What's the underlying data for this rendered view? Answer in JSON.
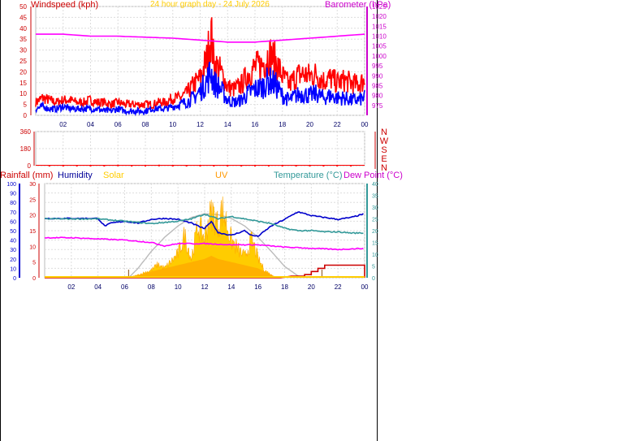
{
  "chart_data": [
    {
      "type": "line",
      "title": "24 hour graph day - 24 July 2026",
      "left_label": "Windspeed (kph)",
      "right_label": "Barometer (hPa)",
      "y_left": {
        "min": 0,
        "max": 50,
        "ticks": [
          0,
          5,
          10,
          15,
          20,
          25,
          30,
          35,
          40,
          45,
          50
        ]
      },
      "y_right": {
        "min": 970,
        "max": 1025,
        "ticks": [
          975,
          980,
          985,
          990,
          995,
          1000,
          1005,
          1010,
          1015,
          1020,
          1025
        ]
      },
      "x_ticks": [
        "02",
        "04",
        "06",
        "08",
        "10",
        "12",
        "14",
        "16",
        "18",
        "20",
        "22",
        "00"
      ],
      "series": [
        {
          "name": "Gust",
          "color": "#ff0000",
          "axis": "left",
          "x": [
            0,
            0.5,
            1,
            1.5,
            2,
            2.5,
            3,
            3.5,
            4,
            4.5,
            5,
            5.5,
            6,
            6.5,
            7,
            7.5,
            8,
            8.5,
            9,
            9.5,
            10,
            10.5,
            11,
            11.5,
            12,
            12.5,
            12.8,
            13,
            13.5,
            14,
            14.5,
            15,
            15.5,
            16,
            16.5,
            17,
            17.5,
            18,
            18.5,
            19,
            19.5,
            20,
            20.5,
            21,
            21.5,
            22,
            22.5,
            23,
            23.5,
            24
          ],
          "values": [
            6,
            8,
            7,
            6,
            7,
            7,
            6,
            6,
            7,
            6,
            6,
            5,
            6,
            5,
            5,
            5,
            5,
            5,
            6,
            6,
            8,
            8,
            10,
            14,
            17,
            26,
            38,
            24,
            20,
            13,
            12,
            14,
            19,
            22,
            23,
            28,
            25,
            18,
            14,
            18,
            19,
            18,
            19,
            16,
            17,
            15,
            16,
            15,
            14,
            16
          ]
        },
        {
          "name": "Wind",
          "color": "#0000ff",
          "axis": "left",
          "x": [
            0,
            0.5,
            1,
            1.5,
            2,
            2.5,
            3,
            3.5,
            4,
            4.5,
            5,
            5.5,
            6,
            6.5,
            7,
            7.5,
            8,
            8.5,
            9,
            9.5,
            10,
            10.5,
            11,
            11.5,
            12,
            12.5,
            12.8,
            13,
            13.5,
            14,
            14.5,
            15,
            15.5,
            16,
            16.5,
            17,
            17.5,
            18,
            18.5,
            19,
            19.5,
            20,
            20.5,
            21,
            21.5,
            22,
            22.5,
            23,
            23.5,
            24
          ],
          "values": [
            3,
            4,
            3,
            3,
            4,
            3,
            3,
            3,
            3,
            3,
            2,
            2,
            3,
            2,
            2,
            2,
            2,
            3,
            3,
            3,
            4,
            5,
            6,
            8,
            11,
            16,
            20,
            15,
            12,
            7,
            6,
            7,
            10,
            12,
            13,
            16,
            14,
            9,
            7,
            9,
            10,
            9,
            10,
            8,
            9,
            8,
            8,
            7,
            7,
            8
          ]
        },
        {
          "name": "Barometer",
          "color": "#ff00ff",
          "axis": "right",
          "x": [
            0,
            2,
            4,
            6,
            8,
            10,
            12,
            14,
            16,
            18,
            20,
            22,
            24
          ],
          "values": [
            1011,
            1011,
            1010,
            1010,
            1009.5,
            1009,
            1008,
            1007,
            1007,
            1008,
            1009,
            1010,
            1011
          ]
        }
      ]
    },
    {
      "type": "scatter",
      "title": "",
      "y_ticks": [
        "360",
        "180",
        "0"
      ],
      "y_range": [
        0,
        360
      ],
      "right_labels": [
        "N",
        "W",
        "S",
        "E",
        "N"
      ],
      "x_range": [
        0,
        24
      ],
      "series": [
        {
          "name": "Wind Direction",
          "color": "#ff0000",
          "x": [
            1,
            2,
            3,
            4,
            5,
            6,
            7,
            8,
            9,
            10,
            11,
            12,
            13,
            14,
            15,
            16,
            17,
            18,
            19,
            20,
            21,
            22,
            23
          ],
          "values": [
            0,
            0,
            0,
            0,
            0,
            2,
            0,
            0,
            2,
            0,
            0,
            0,
            0,
            0,
            0,
            0,
            0,
            0,
            0,
            0,
            0,
            0,
            0
          ]
        }
      ]
    },
    {
      "type": "area",
      "labels": {
        "rainfall": "Rainfall (mm)",
        "humidity": "Humidity",
        "solar": "Solar",
        "uv": "UV",
        "temperature": "Temperature (°C)",
        "dewpoint": "Dew Point (°C)"
      },
      "y_hum": {
        "min": 0,
        "max": 100,
        "ticks": [
          0,
          10,
          20,
          30,
          40,
          50,
          60,
          70,
          80,
          90,
          100
        ]
      },
      "y_rain": {
        "min": 0,
        "max": 30,
        "ticks": [
          0,
          5,
          10,
          15,
          20,
          25,
          30
        ]
      },
      "y_temp": {
        "min": 0,
        "max": 40,
        "ticks": [
          0,
          5,
          10,
          15,
          20,
          25,
          30,
          35,
          40
        ]
      },
      "x_ticks": [
        "02",
        "04",
        "06",
        "08",
        "10",
        "12",
        "14",
        "16",
        "18",
        "20",
        "22",
        "00"
      ],
      "series": [
        {
          "name": "Humidity",
          "color": "#0000cc",
          "axis": "hum",
          "x": [
            0,
            1,
            2,
            3,
            4,
            4.5,
            5,
            6,
            7,
            8,
            9,
            10,
            11,
            12,
            12.5,
            13,
            14,
            15,
            15.5,
            16,
            17,
            18,
            19,
            20,
            21,
            22,
            23,
            24
          ],
          "values": [
            63,
            63,
            63,
            63,
            63,
            55,
            58,
            60,
            58,
            62,
            63,
            62,
            58,
            52,
            60,
            48,
            45,
            50,
            45,
            44,
            55,
            62,
            70,
            66,
            64,
            62,
            64,
            68
          ]
        },
        {
          "name": "Temperature",
          "color": "#339999",
          "axis": "temp",
          "x": [
            0,
            2,
            4,
            6,
            8,
            10,
            11,
            12,
            13,
            14,
            15,
            16,
            17,
            18,
            19,
            20,
            21,
            22,
            23,
            24
          ],
          "values": [
            25,
            25,
            25,
            24,
            23,
            24,
            25,
            27,
            25,
            26,
            25,
            24,
            23,
            21,
            20,
            20,
            19.5,
            19.5,
            19,
            19
          ]
        },
        {
          "name": "Dew Point",
          "color": "#ff00ff",
          "axis": "temp",
          "x": [
            0,
            2,
            4,
            6,
            8,
            9,
            10,
            12,
            14,
            16,
            18,
            20,
            22,
            24
          ],
          "values": [
            17,
            17,
            16.5,
            16,
            15,
            13.5,
            14.5,
            14.5,
            14,
            14,
            13,
            12.5,
            12,
            12.5
          ]
        },
        {
          "name": "Solar Max",
          "color": "#bbbbbb",
          "axis": "hum",
          "x": [
            6.3,
            7,
            8,
            9,
            10,
            11,
            12,
            13,
            14,
            15,
            16,
            17,
            18,
            19,
            19.5
          ],
          "values": [
            0,
            10,
            28,
            43,
            55,
            64,
            68,
            67,
            63,
            55,
            43,
            28,
            12,
            2,
            0
          ]
        },
        {
          "name": "Solar",
          "color": "#ffcc00",
          "axis": "hum",
          "x": [
            6.3,
            7,
            8,
            8.5,
            9,
            10,
            10.5,
            11,
            11.5,
            12,
            12.3,
            12.6,
            13,
            13.3,
            13.6,
            14,
            14.5,
            15,
            15.5,
            15.8,
            16,
            16.5,
            17,
            17.5
          ],
          "values": [
            0,
            3,
            8,
            14,
            10,
            25,
            45,
            20,
            55,
            42,
            62,
            70,
            55,
            72,
            60,
            40,
            30,
            22,
            40,
            30,
            20,
            8,
            3,
            0
          ]
        },
        {
          "name": "UV",
          "color": "#ff9900",
          "axis": "rain",
          "x": [
            6.3,
            8,
            9,
            10,
            11,
            12,
            12.5,
            13,
            14,
            15,
            16,
            17,
            17.5
          ],
          "values": [
            0,
            2,
            3,
            4,
            5,
            6,
            7,
            6,
            5,
            4,
            3,
            1,
            0
          ]
        },
        {
          "name": "Rainfall",
          "color": "#cc0000",
          "axis": "rain",
          "x": [
            0,
            17.7,
            18.5,
            19.5,
            20,
            20.5,
            21,
            23,
            23.9,
            24
          ],
          "values": [
            0,
            0,
            0.5,
            1,
            2,
            3,
            4,
            4,
            4,
            0
          ]
        }
      ]
    }
  ]
}
